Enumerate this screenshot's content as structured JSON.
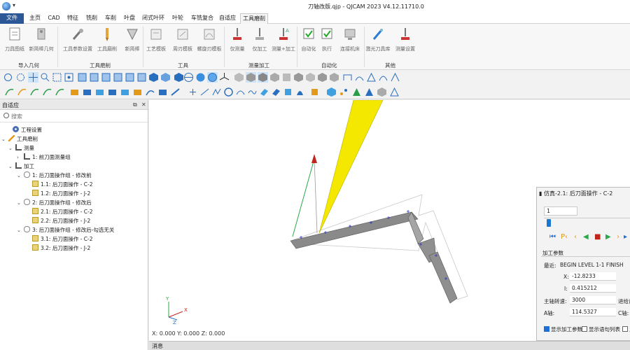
{
  "window": {
    "title": "刀轴改版.qjp - QJCAM 2023 V4.12.11710.0",
    "quick_access": "▾"
  },
  "menu": {
    "file": "文件",
    "tabs": [
      "主页",
      "CAD",
      "特征",
      "铣削",
      "车削",
      "叶盘",
      "闭式叶环",
      "叶轮",
      "车铣复合",
      "自适应",
      "工具磨削"
    ],
    "active": "工具磨削"
  },
  "ribbon": {
    "buttons": [
      {
        "label": "刀具图纸",
        "icon": "drawing-icon"
      },
      {
        "label": "新简棒几何",
        "icon": "bar-geometry-icon"
      },
      {
        "label": "工具参数设置",
        "icon": "tool-params-icon"
      },
      {
        "label": "工具磨削",
        "icon": "tool-grind-icon"
      },
      {
        "label": "新简棒",
        "icon": "new-bar-icon"
      },
      {
        "label": "工艺模板",
        "icon": "process-template-icon"
      },
      {
        "label": "周刃模板",
        "icon": "peripheral-edge-template-icon"
      },
      {
        "label": "螺旋刃模板",
        "icon": "helical-edge-template-icon"
      },
      {
        "label": "仅测量",
        "icon": "measure-only-icon"
      },
      {
        "label": "仅加工",
        "icon": "machine-only-icon"
      },
      {
        "label": "测量+加工",
        "icon": "measure-machine-icon"
      },
      {
        "label": "自动化",
        "icon": "automation-icon"
      },
      {
        "label": "执行",
        "icon": "execute-icon"
      },
      {
        "label": "连接机床",
        "icon": "connect-machine-icon"
      },
      {
        "label": "激光刀具库",
        "icon": "laser-tool-library-icon"
      },
      {
        "label": "测量设置",
        "icon": "measure-settings-icon"
      }
    ],
    "groups": [
      "导入几何",
      "工具磨削",
      "工具",
      "测量加工",
      "自动化",
      "其他"
    ]
  },
  "left_panel": {
    "title": "自适应",
    "search_placeholder": "搜索",
    "tree": [
      {
        "label": "工程设置",
        "icon": "gear-icon"
      },
      {
        "label": "工具磨削",
        "icon": "brush-icon"
      },
      {
        "label": "测量",
        "icon": "measure-icon"
      },
      {
        "label": "1: 前刀面测量组",
        "icon": "measure-group-icon"
      },
      {
        "label": "加工",
        "icon": "machining-icon"
      },
      {
        "label": "1: 后刀面操作组 - 修改前",
        "icon": "clip-icon"
      },
      {
        "label": "1.1: 后刀面操作 - C-2",
        "icon": "operation-icon"
      },
      {
        "label": "1.2: 后刀面操作 - J-2",
        "icon": "operation-icon"
      },
      {
        "label": "2: 后刀面操作组 - 修改后",
        "icon": "clip-icon"
      },
      {
        "label": "2.1: 后刀面操作 - C-2",
        "icon": "operation-icon"
      },
      {
        "label": "2.2: 后刀面操作 - J-2",
        "icon": "operation-icon"
      },
      {
        "label": "3: 后刀面操作组 - 修改后-勾选无关",
        "icon": "clip-icon"
      },
      {
        "label": "3.1: 后刀面操作 - C-2",
        "icon": "operation-icon"
      },
      {
        "label": "3.2: 后刀面操作 - J-2",
        "icon": "operation-icon"
      }
    ]
  },
  "viewport": {
    "coords": "X: 0.000  Y: 0.000  Z: 0.000"
  },
  "message_bar": {
    "label": "消息"
  },
  "sim_panel": {
    "title": "仿真-2.1: 后刀面操作 - C-2",
    "frame_value": "1",
    "progress": 0.02,
    "section": "加工参数",
    "current_label": "最近:",
    "current_value": "BEGIN LEVEL 1-1 FINISH",
    "x_label": "X:",
    "x_value": "-12.8233",
    "i_label": "I:",
    "i_value": "0.415212",
    "spindle_label": "主轴转速:",
    "spindle_value": "3000",
    "feed_label": "进给速",
    "a_label": "A轴:",
    "a_value": "114.5327",
    "c_label": "C轴:",
    "show_params": "显示加工参数",
    "show_lines": "显示语句列表",
    "show_extra": "显"
  },
  "colors": {
    "accent": "#1e6fd9",
    "file_tab": "#2b5797",
    "tool_cone": "#f5e800",
    "path": "#3333cc"
  }
}
